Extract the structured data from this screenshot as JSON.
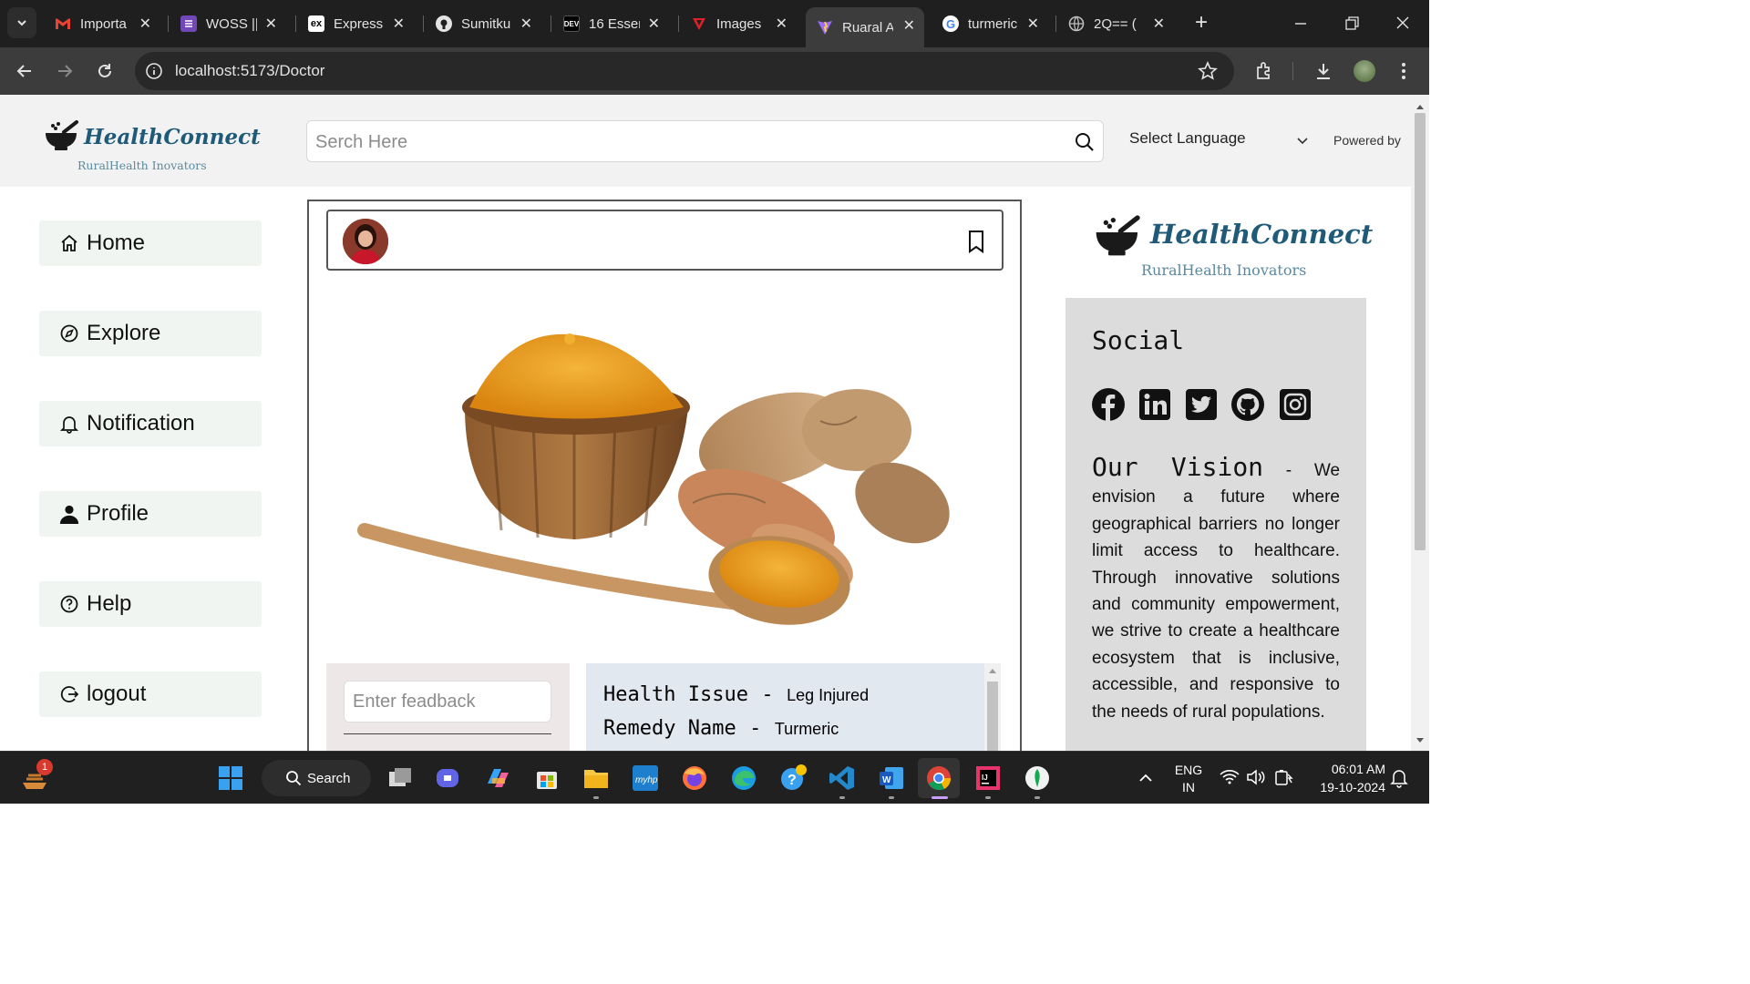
{
  "browser": {
    "tabs": [
      {
        "title": "Importa",
        "icon": "gmail-icon"
      },
      {
        "title": "WOSS ||",
        "icon": "forms-icon"
      },
      {
        "title": "Express",
        "icon": "express-icon"
      },
      {
        "title": "Sumitku",
        "icon": "github-icon"
      },
      {
        "title": "16 Esser",
        "icon": "dev-icon"
      },
      {
        "title": "Images",
        "icon": "vercel-icon"
      },
      {
        "title": "Ruaral A",
        "icon": "vite-icon"
      },
      {
        "title": "turmeric",
        "icon": "google-icon"
      },
      {
        "title": "2Q== (",
        "icon": "globe-icon"
      }
    ],
    "url": "localhost:5173/Doctor"
  },
  "header": {
    "brand": "HealthConnect",
    "tagline": "RuralHealth Inovators",
    "search_placeholder": "Serch Here",
    "language": "Select Language",
    "powered_by": "Powered by"
  },
  "sidebar": {
    "items": [
      {
        "label": "Home",
        "icon": "home-icon"
      },
      {
        "label": "Explore",
        "icon": "compass-icon"
      },
      {
        "label": "Notification",
        "icon": "bell-icon"
      },
      {
        "label": "Profile",
        "icon": "user-icon"
      },
      {
        "label": "Help",
        "icon": "help-icon"
      },
      {
        "label": "logout",
        "icon": "logout-icon"
      }
    ]
  },
  "post": {
    "image_subject": "turmeric-powder-and-roots",
    "feedback_placeholder": "Enter feadback",
    "issue_label": "Health Issue",
    "issue_value": "Leg Injured",
    "remedy_label": "Remedy Name",
    "remedy_value": "Turmeric",
    "separator": "-"
  },
  "right_panel": {
    "brand": "HealthConnect",
    "tagline": "RuralHealth Inovators",
    "social_title": "Social",
    "social_icons": [
      "facebook-icon",
      "linkedin-icon",
      "twitter-icon",
      "github-icon",
      "instagram-icon"
    ],
    "vision_title": "Our Vision",
    "vision_text": " - We envision a future where geographical barriers no longer limit access to healthcare. Through innovative solutions and community empowerment, we strive to create a healthcare ecosystem that is inclusive, accessible, and responsive to the needs of rural populations."
  },
  "taskbar": {
    "search": "Search",
    "lang_top": "ENG",
    "lang_bottom": "IN",
    "time": "06:01 AM",
    "date": "19-10-2024",
    "notif_count": "1"
  },
  "colors": {
    "brand": "#1f5a78",
    "turmeric": "#e8a11d",
    "panel": "#dcdcdc"
  }
}
